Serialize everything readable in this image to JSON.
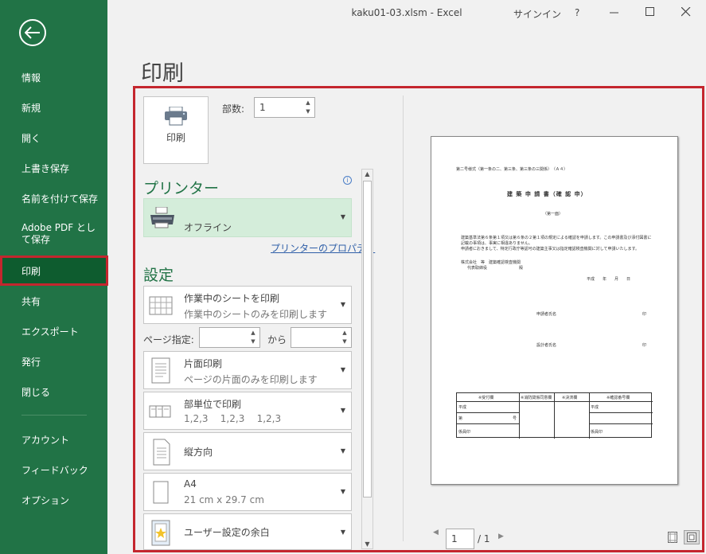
{
  "window": {
    "title": "kaku01-03.xlsm  -  Excel",
    "signin": "サインイン",
    "help": "?"
  },
  "sidebar": {
    "items": [
      {
        "label": "情報"
      },
      {
        "label": "新規"
      },
      {
        "label": "開く"
      },
      {
        "label": "上書き保存"
      },
      {
        "label": "名前を付けて保存"
      },
      {
        "label": "Adobe PDF として保存"
      },
      {
        "label": "印刷"
      },
      {
        "label": "共有"
      },
      {
        "label": "エクスポート"
      },
      {
        "label": "発行"
      },
      {
        "label": "閉じる"
      },
      {
        "label": "アカウント"
      },
      {
        "label": "フィードバック"
      },
      {
        "label": "オプション"
      }
    ]
  },
  "page": {
    "title": "印刷"
  },
  "print": {
    "button_label": "印刷",
    "copies_label": "部数:",
    "copies_value": "1"
  },
  "printer": {
    "heading": "プリンター",
    "status": "オフライン",
    "properties_link": "プリンターのプロパティ"
  },
  "settings": {
    "heading": "設定",
    "sheet": {
      "title": "作業中のシートを印刷",
      "sub": "作業中のシートのみを印刷します"
    },
    "pages_label": "ページ指定:",
    "pages_to": "から",
    "sides": {
      "title": "片面印刷",
      "sub": "ページの片面のみを印刷します"
    },
    "collate": {
      "title": "部単位で印刷",
      "sub": "1,2,3    1,2,3    1,2,3"
    },
    "orientation": {
      "title": "縦方向"
    },
    "paper": {
      "title": "A4",
      "sub": "21 cm x 29.7 cm"
    },
    "margins": {
      "title": "ユーザー設定の余白"
    }
  },
  "preview": {
    "page_current": "1",
    "page_total": "/ 1",
    "doc": {
      "header": "第二号様式（第一条の二、第三条、第三条の三関係）　（Ａ４）",
      "title": "建 築 申 請 書（確 認 申）",
      "sub": "（第一面）",
      "para1": "建築基準法第６条第１項又は第６条の２第１項の規定による確認を申請します。この申請書及び添付図書に記載の事項は、事実に相違ありません。",
      "para2": "申請者におきまして、特定行政庁等認可の建築主事又は指定確認検査機関に対して申請いたします。",
      "to1": "株式会社　等　建築確認検査機関",
      "to2": "代表取締役　　　　　　　　殿",
      "date": "平成　　年　　月　　日",
      "applicant": "申請者氏名",
      "seal1": "印",
      "agent": "設計者氏名",
      "seal2": "印",
      "table_headers": [
        "※受付欄",
        "※消防関係同意欄",
        "※決済欄",
        "※確認番号欄"
      ],
      "table_cells": [
        "平成",
        "第",
        "号",
        "係員印",
        "平成",
        "係員印"
      ]
    }
  }
}
